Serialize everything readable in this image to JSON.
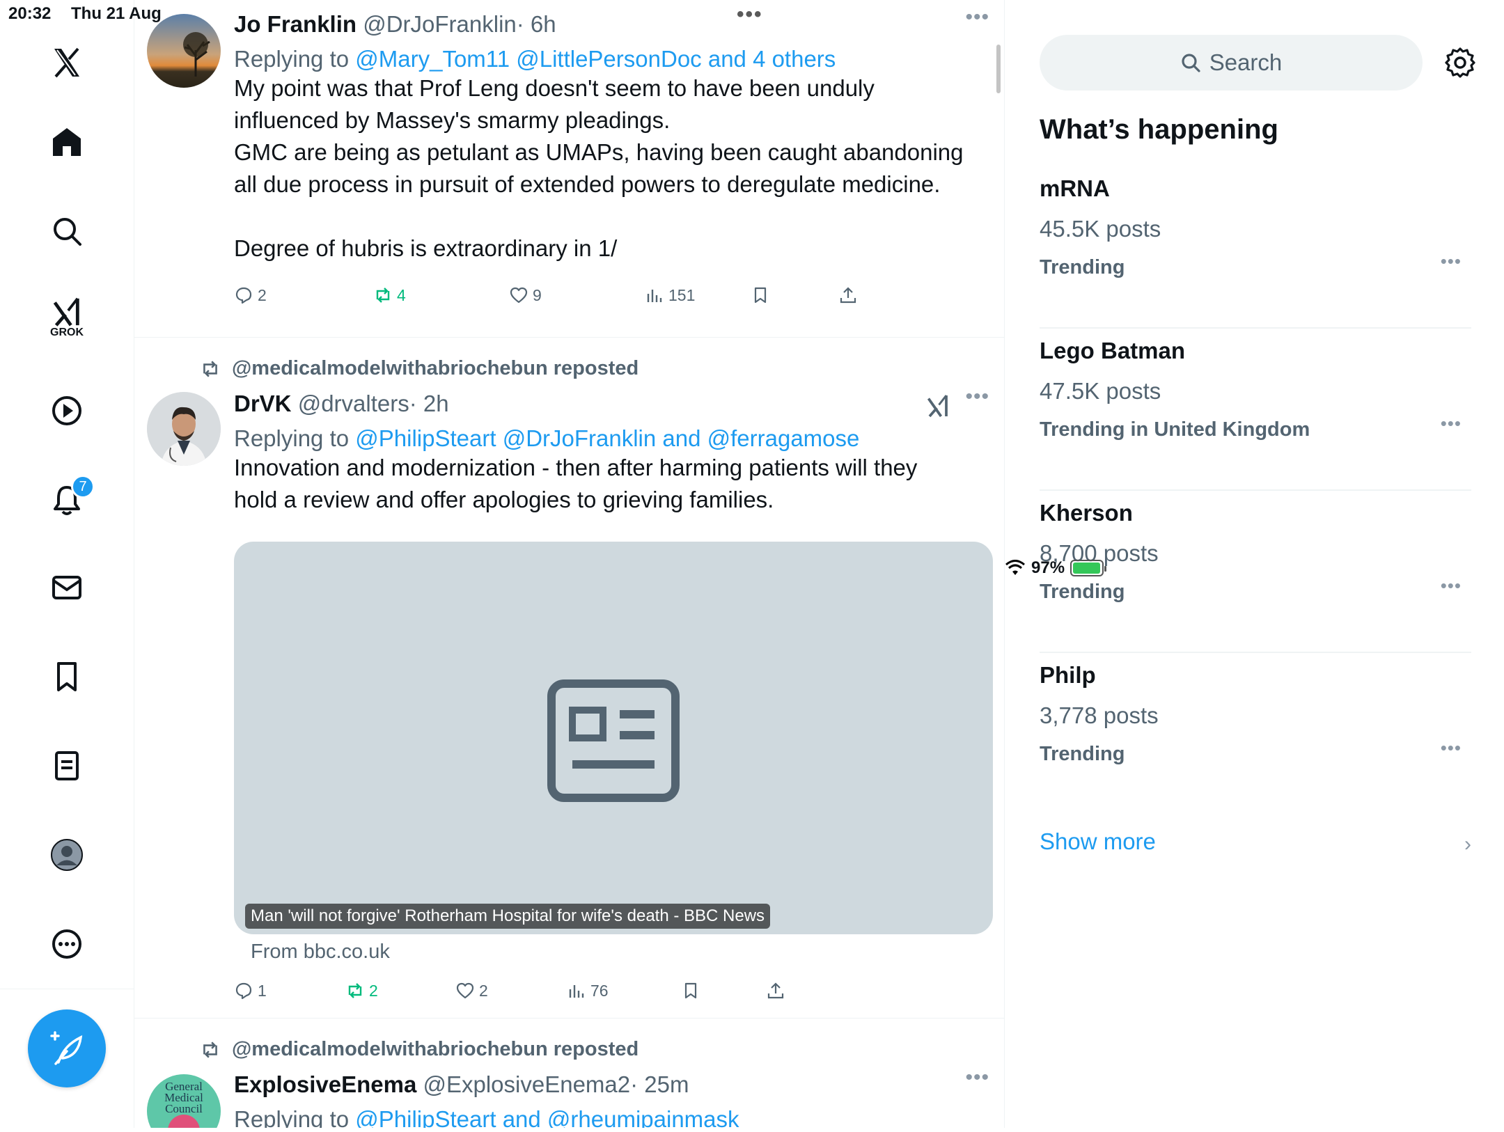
{
  "status": {
    "time": "20:32",
    "date": "Thu 21 Aug",
    "battery": "97%",
    "battery_level": 0.97
  },
  "nav": {
    "grok_label": "GROK",
    "notifications_badge": "7"
  },
  "posts": [
    {
      "name": "Jo Franklin",
      "handle": "@DrJoFranklin",
      "time": "· 6h",
      "replying_prefix": "Replying to ",
      "replying_links": "@Mary_Tom11 @LittlePersonDoc and 4 others",
      "lines": [
        "My point was that Prof Leng doesn't seem to have been unduly",
        "influenced by Massey's smarmy pleadings.",
        "GMC are being as petulant as UMAPs, having been caught abandoning",
        "all due process in pursuit of extended powers to deregulate medicine.",
        "",
        "Degree of hubris is extraordinary in 1/"
      ],
      "replies": "2",
      "reposts": "4",
      "likes": "9",
      "views": "151"
    },
    {
      "repost_by": "@medicalmodelwithabriochebun reposted",
      "name": "DrVK",
      "handle": "@drvalters",
      "time": "· 2h",
      "replying_prefix": "Replying to ",
      "replying_links": "@PhilipSteart @DrJoFranklin and @ferragamose",
      "lines": [
        "Innovation and modernization - then after harming patients will they",
        "hold a review and offer apologies to grieving families."
      ],
      "media_caption": "Man 'will not forgive' Rotherham Hospital for wife's death - BBC News",
      "from": "From bbc.co.uk",
      "replies": "1",
      "reposts": "2",
      "likes": "2",
      "views": "76"
    },
    {
      "repost_by": "@medicalmodelwithabriochebun reposted",
      "name": "ExplosiveEnema",
      "handle": "@ExplosiveEnema2",
      "time": "· 25m",
      "replying_prefix": "Replying to ",
      "replying_links": "@PhilipSteart and @rheumipainmask",
      "avatar_text": "General Medical Council"
    }
  ],
  "sidebar": {
    "search_placeholder": "Search",
    "heading": "What’s happening",
    "trends": [
      {
        "title": "mRNA",
        "count": "45.5K posts",
        "subtitle": "Trending"
      },
      {
        "title": "Lego Batman",
        "count": "47.5K posts",
        "subtitle": "Trending in United Kingdom"
      },
      {
        "title": "Kherson",
        "count": "8,700 posts",
        "subtitle": "Trending"
      },
      {
        "title": "Philp",
        "count": "3,778 posts",
        "subtitle": "Trending"
      }
    ],
    "show_more": "Show more"
  },
  "colors": {
    "accent": "#1d9bf0",
    "repost_green": "#00ba7c",
    "muted": "#536471"
  }
}
